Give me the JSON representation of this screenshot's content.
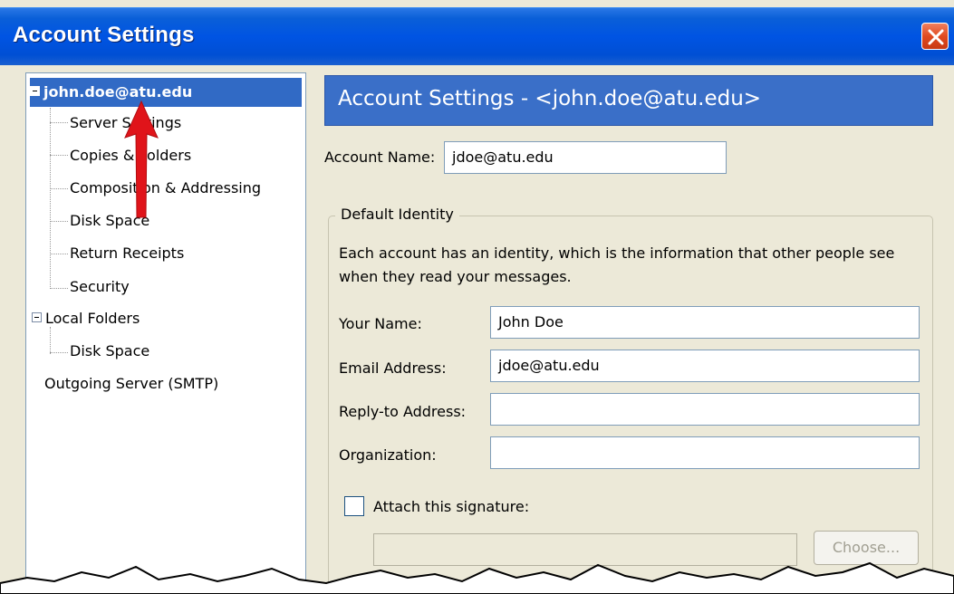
{
  "window": {
    "title": "Account Settings"
  },
  "tree": {
    "account": "john.doe@atu.edu",
    "account_children": [
      "Server Settings",
      "Copies & Folders",
      "Composition & Addressing",
      "Disk Space",
      "Return Receipts",
      "Security"
    ],
    "local_folders": "Local Folders",
    "local_children": [
      "Disk Space"
    ],
    "outgoing": "Outgoing Server (SMTP)"
  },
  "panel": {
    "header": "Account Settings - <john.doe@atu.edu>",
    "account_name_label": "Account Name:",
    "account_name_value": "jdoe@atu.edu",
    "group_title": "Default Identity",
    "description_line1": "Each account has an identity, which is the information that other people see",
    "description_line2": "when they read your messages.",
    "your_name_label": "Your Name:",
    "your_name_value": "John Doe",
    "email_label": "Email Address:",
    "email_value": "jdoe@atu.edu",
    "reply_to_label": "Reply-to Address:",
    "reply_to_value": "",
    "organization_label": "Organization:",
    "organization_value": "",
    "attach_signature_label": "Attach this signature:",
    "attach_signature_checked": false,
    "choose_button": "Choose..."
  },
  "colors": {
    "titlebar": "#0054e3",
    "selection": "#316ac5",
    "header_bar": "#3a6fc8",
    "close_button": "#e04a20",
    "annotation_arrow": "#e0141a"
  },
  "icons": {
    "close": "close-icon",
    "expander": "collapse-minus-icon",
    "annotation": "red-arrow-icon"
  }
}
